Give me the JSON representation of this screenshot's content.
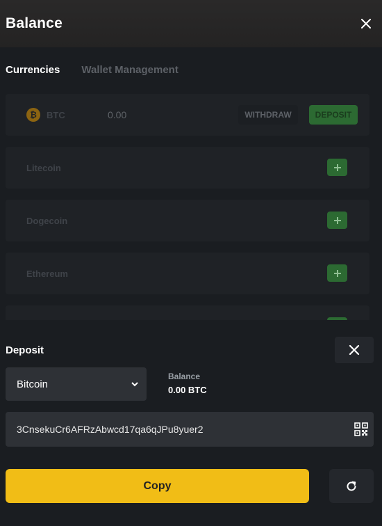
{
  "header": {
    "title": "Balance",
    "close_icon": "close-icon"
  },
  "tabs": [
    {
      "label": "Currencies",
      "active": true
    },
    {
      "label": "Wallet Management",
      "active": false
    }
  ],
  "currencies": {
    "btc": {
      "ticker": "BTC",
      "amount": "0.00",
      "withdraw_label": "WITHDRAW",
      "deposit_label": "DEPOSIT"
    },
    "others": [
      {
        "name": "Litecoin"
      },
      {
        "name": "Dogecoin"
      },
      {
        "name": "Ethereum"
      }
    ]
  },
  "deposit": {
    "title": "Deposit",
    "selected_currency": "Bitcoin",
    "balance_label": "Balance",
    "balance_value": "0.00 BTC",
    "address": "3CnsekuCr6AFRzAbwcd17qa6qJPu8yuer2",
    "copy_label": "Copy"
  },
  "colors": {
    "accent": "#f1bd16",
    "success": "#2c6a32",
    "background": "#1a1d21"
  }
}
